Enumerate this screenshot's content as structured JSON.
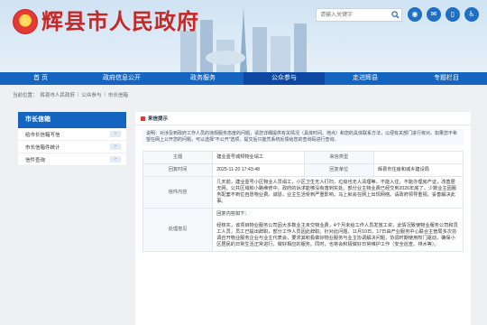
{
  "header": {
    "site_title": "辉县市人民政府",
    "search_placeholder": "请输入关键字",
    "emblem_icon": "national-emblem-icon",
    "icons": [
      "weibo-icon",
      "wechat-icon",
      "mobile-icon",
      "accessibility-icon"
    ]
  },
  "nav": {
    "items": [
      "首 页",
      "政府信息公开",
      "政务服务",
      "公众参与",
      "走进辉县",
      "专题栏目"
    ],
    "active_index": 3
  },
  "breadcrumb": [
    "当前位置：",
    "辉县市人民政府",
    "公众参与",
    "市长信箱"
  ],
  "sidebar": {
    "title": "市长信箱",
    "items": [
      {
        "label": "给市长信箱写信"
      },
      {
        "label": "市长信箱件统计"
      },
      {
        "label": "信件查询"
      }
    ]
  },
  "section": {
    "title": "来信提示"
  },
  "notice": "说明：对涉及到政府工作人员的违规服务态度的问题，请您详细提供有关情况（具体时间、地点）和您的具体联系方法，以便有关部门进行核对。如果您不希望在网上公开您的问题，可以选择\"不公开\"选项，提交后只能凭系统反馈给您的查询码进行查询。",
  "letter": {
    "subject_label": "主题",
    "subject_value": "建业壹号城邦物业塌工",
    "type_label": "来信类型",
    "type_value": "",
    "sent_time_label": "来信时间",
    "sent_time_value": "2025-11-12 09:26:09",
    "reply_time_label": "回复时间",
    "reply_time_value": "2025-11-20 17:43:48",
    "reply_unit_label": "回复单位",
    "reply_unit_value": "辉县市住房和城乡建设局",
    "content_label": "信件内容",
    "content_value": "几天前，建业壹号小区物业人员塌工，小区卫生无人打扫，垃圾也无人清理等，不能入住，不能办理房产证，改善居无网。公共区域和小路维修中。政府的诉求能够没有落到实处。部分业主物业费已经交到2026年底了。少数业主因服务配套不到位自愿物业费。诚恳，业主生活受到严重影响，马上就会在网上出现网络。请政府领导重视，妥善解决此事。",
    "opinion_label": "处理意见",
    "opinion_greeting": "回复内容如下：",
    "opinion_value": "经核实，该项目物业服务公司因大多数业主未交物业费，4个月未给工作人员发放工资，此情况致使物业服务公司和员工人员，员工已提出辞职，部分工作人员因此辞职。针对此问题，11月10日、17日由产业服务中心联合主管局多次协调召开物业服务企业与业主代表会，要求其积极做好物业服务与业主协调解决问题，协调时期使用权门驱动，确保小区居民的日常生活正常进行，做好相应的服务。同时，也将会积极做好日常维护工作（安全巡查、排水等）。"
  },
  "colors": {
    "nav_bg": "#1565c0",
    "title_red": "#c62828"
  }
}
